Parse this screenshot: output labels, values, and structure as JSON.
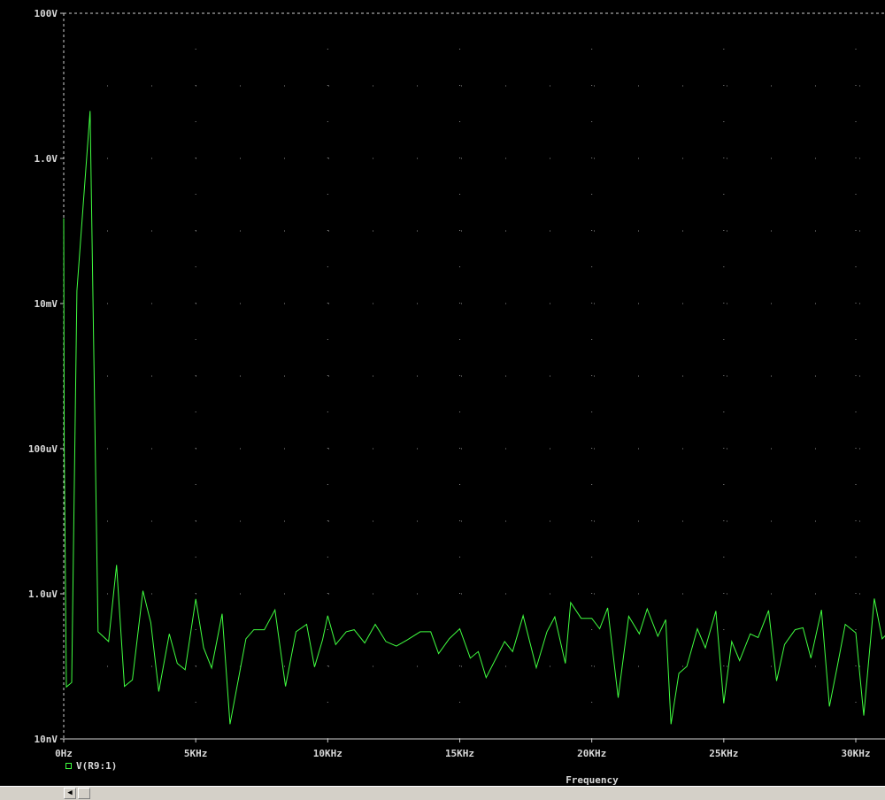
{
  "chart_data": {
    "type": "line",
    "xlabel": "Frequency",
    "x_unit": "Hz",
    "xlim": [
      0,
      31000
    ],
    "x_ticks": [
      {
        "value": 0,
        "label": "0Hz"
      },
      {
        "value": 5000,
        "label": "5KHz"
      },
      {
        "value": 10000,
        "label": "10KHz"
      },
      {
        "value": 15000,
        "label": "15KHz"
      },
      {
        "value": 20000,
        "label": "20KHz"
      },
      {
        "value": 25000,
        "label": "25KHz"
      },
      {
        "value": 30000,
        "label": "30KHz"
      }
    ],
    "y_scale": "log",
    "y_unit": "V",
    "ylim": [
      1e-08,
      100
    ],
    "y_ticks": [
      {
        "value": 100,
        "label": "100V"
      },
      {
        "value": 1,
        "label": "1.0V"
      },
      {
        "value": 0.01,
        "label": "10mV"
      },
      {
        "value": 0.0001,
        "label": "100uV"
      },
      {
        "value": 1e-06,
        "label": "1.0uV"
      },
      {
        "value": 1e-08,
        "label": "10nV"
      }
    ],
    "grid": true,
    "legend_position": "bottom-left",
    "series": [
      {
        "name": "V(R9:1)",
        "color": "#40ff40",
        "points": [
          [
            0,
            0.15
          ],
          [
            20,
            0.0001
          ],
          [
            100,
            5.2e-08
          ],
          [
            300,
            6e-08
          ],
          [
            500,
            0.015
          ],
          [
            1000,
            4.5
          ],
          [
            1300,
            3e-07
          ],
          [
            1700,
            2.2e-07
          ],
          [
            2000,
            2.5e-06
          ],
          [
            2300,
            5.3e-08
          ],
          [
            2600,
            6.5e-08
          ],
          [
            3000,
            1.1e-06
          ],
          [
            3300,
            4e-07
          ],
          [
            3600,
            4.5e-08
          ],
          [
            4000,
            2.8e-07
          ],
          [
            4300,
            1.1e-07
          ],
          [
            4600,
            9e-08
          ],
          [
            5000,
            8.5e-07
          ],
          [
            5300,
            1.8e-07
          ],
          [
            5600,
            9.5e-08
          ],
          [
            6000,
            5.3e-07
          ],
          [
            6300,
            1.6e-08
          ],
          [
            6900,
            2.4e-07
          ],
          [
            7200,
            3.2e-07
          ],
          [
            7600,
            3.2e-07
          ],
          [
            8000,
            6e-07
          ],
          [
            8400,
            5.3e-08
          ],
          [
            8800,
            3e-07
          ],
          [
            9200,
            3.8e-07
          ],
          [
            9500,
            9.8e-08
          ],
          [
            9800,
            2.3e-07
          ],
          [
            10000,
            5e-07
          ],
          [
            10300,
            2e-07
          ],
          [
            10700,
            3e-07
          ],
          [
            11000,
            3.2e-07
          ],
          [
            11400,
            2.1e-07
          ],
          [
            11800,
            3.8e-07
          ],
          [
            12200,
            2.2e-07
          ],
          [
            12600,
            1.9e-07
          ],
          [
            13000,
            2.3e-07
          ],
          [
            13500,
            3e-07
          ],
          [
            13900,
            3e-07
          ],
          [
            14200,
            1.5e-07
          ],
          [
            14600,
            2.4e-07
          ],
          [
            15000,
            3.3e-07
          ],
          [
            15400,
            1.3e-07
          ],
          [
            15700,
            1.6e-07
          ],
          [
            16000,
            7e-08
          ],
          [
            16700,
            2.2e-07
          ],
          [
            17000,
            1.6e-07
          ],
          [
            17400,
            5e-07
          ],
          [
            17900,
            9.6e-08
          ],
          [
            18300,
            3e-07
          ],
          [
            18600,
            4.8e-07
          ],
          [
            19000,
            1.1e-07
          ],
          [
            19200,
            7.6e-07
          ],
          [
            19600,
            4.6e-07
          ],
          [
            20000,
            4.6e-07
          ],
          [
            20300,
            3.3e-07
          ],
          [
            20600,
            6.4e-07
          ],
          [
            21000,
            3.7e-08
          ],
          [
            21400,
            4.9e-07
          ],
          [
            21800,
            2.8e-07
          ],
          [
            22100,
            6.2e-07
          ],
          [
            22500,
            2.6e-07
          ],
          [
            22800,
            4.4e-07
          ],
          [
            23000,
            1.6e-08
          ],
          [
            23300,
            8e-08
          ],
          [
            23600,
            1e-07
          ],
          [
            24000,
            3.3e-07
          ],
          [
            24300,
            1.8e-07
          ],
          [
            24700,
            5.8e-07
          ],
          [
            25000,
            3.1e-08
          ],
          [
            25300,
            2.2e-07
          ],
          [
            25600,
            1.2e-07
          ],
          [
            26000,
            2.8e-07
          ],
          [
            26300,
            2.5e-07
          ],
          [
            26700,
            5.9e-07
          ],
          [
            27000,
            6.3e-08
          ],
          [
            27300,
            2e-07
          ],
          [
            27700,
            3.2e-07
          ],
          [
            28000,
            3.4e-07
          ],
          [
            28300,
            1.3e-07
          ],
          [
            28700,
            6e-07
          ],
          [
            29000,
            2.8e-08
          ],
          [
            29300,
            1e-07
          ],
          [
            29600,
            3.8e-07
          ],
          [
            30000,
            2.9e-07
          ],
          [
            30300,
            2.1e-08
          ],
          [
            30700,
            8.6e-07
          ],
          [
            31000,
            2.4e-07
          ],
          [
            31300,
            3.1e-07
          ]
        ]
      }
    ]
  },
  "legend": {
    "label": "V(R9:1)"
  },
  "scrollbar": {
    "left_arrow": "◀"
  }
}
